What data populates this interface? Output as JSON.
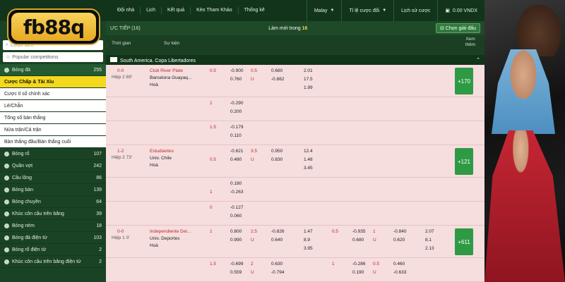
{
  "topnav": [
    "Đội nhà",
    "Lịch",
    "Kết quả",
    "Kèo Tham Khảo",
    "Thống kê"
  ],
  "topright": {
    "region": "Malay",
    "odds": "Tỉ lệ cược đổi",
    "history": "Lịch sử cược",
    "balance": "0.00 VNDX"
  },
  "logo": "fb88q",
  "header": {
    "live": "ỰC TIẾP (16)",
    "refresh_label": "Làm mới trong",
    "refresh_count": "16",
    "pick": "Chọn giải đấu"
  },
  "cols": {
    "time": "Thời gian",
    "event": "Sự kiện",
    "more": "Xem thêm"
  },
  "league": "South America. Copa Libertadores",
  "sidebar": {
    "search_placeholder": "Cược xiên",
    "popular": "Popular competitions",
    "football": {
      "label": "Bóng đá",
      "count": "255"
    },
    "sub": [
      "Cược Chấp & Tài Xỉu",
      "Cược tỉ số chính xác",
      "Lẻ/Chẵn",
      "Tổng số bàn thắng",
      "Nửa trận/Cả trận",
      "Bàn thắng đầu/Bàn thắng cuối"
    ],
    "sports": [
      {
        "label": "Bóng rổ",
        "count": "107"
      },
      {
        "label": "Quần vợt",
        "count": "242"
      },
      {
        "label": "Cầu lông",
        "count": "86"
      },
      {
        "label": "Bóng bàn",
        "count": "139"
      },
      {
        "label": "Bóng chuyền",
        "count": "64"
      },
      {
        "label": "Khúc côn cầu trên băng",
        "count": "39"
      },
      {
        "label": "Bóng ném",
        "count": "18"
      },
      {
        "label": "Bóng đá điện tử",
        "count": "103"
      },
      {
        "label": "Bóng rổ điện tử",
        "count": "2"
      },
      {
        "label": "Khúc côn cầu trên băng điện tử",
        "count": "2"
      }
    ]
  },
  "matches": [
    {
      "score": "0-0",
      "time": "Hiệp 2 69'",
      "home": "Club River Plate",
      "away": "Barcelona Guayaq...",
      "draw": "Hoà",
      "more": "+170",
      "lines": [
        [
          "0.5",
          "-0.900",
          "0.5",
          "0.680",
          "2.01"
        ],
        [
          "",
          "0.760",
          "U",
          "-0.862",
          "17.5"
        ],
        [
          "",
          "",
          "",
          "",
          "1.99"
        ]
      ]
    },
    {
      "score": "1-2",
      "time": "Hiệp 2 73'",
      "home": "Estudiantes",
      "away": "Univ. Chile",
      "draw": "Hoà",
      "more": "+121",
      "lines": [
        [
          "",
          "-0.621",
          "3.5",
          "0.950",
          "12.4"
        ],
        [
          "0.5",
          "0.480",
          "U",
          "0.830",
          "1.48"
        ],
        [
          "",
          "",
          "",
          "",
          "3.45"
        ]
      ]
    },
    {
      "score": "0-0",
      "time": "Hiệp 1 0'",
      "home": "Independiente Del...",
      "away": "Univ. Deportes",
      "draw": "Hoà",
      "more": "+611",
      "lines": [
        [
          "1",
          "0.800",
          "2.5",
          "-0.826",
          "1.47"
        ],
        [
          "",
          "0.990",
          "U",
          "0.640",
          "8.9"
        ],
        [
          "",
          "",
          "",
          "",
          "3.95"
        ]
      ],
      "lines2": [
        [
          "0.5",
          "-0.935",
          "1",
          "-0.840",
          "2.07"
        ],
        [
          "",
          "0.680",
          "U",
          "0.620",
          "8.1"
        ],
        [
          "",
          "",
          "",
          "",
          "2.13"
        ]
      ]
    }
  ],
  "subrows": [
    {
      "h": "1",
      "a": "-0.290",
      "b": "0.200"
    },
    {
      "h": "1.5",
      "a": "-0.179",
      "b": "0.110"
    },
    {
      "h": "",
      "a": "0.180",
      "b": "-0.263",
      "h2": "1"
    },
    {
      "h": "0",
      "a": "-0.127",
      "b": "0.060"
    },
    {
      "h": "1.5",
      "a": "-0.699",
      "b": "0.559",
      "c": "2",
      "d": "0.630",
      "e": "U",
      "f": "-0.794",
      "g": "1",
      "i": "-0.286",
      "j": "0.5",
      "k": "0.460",
      "l": "0.190",
      "m": "U",
      "n": "-0.633"
    }
  ]
}
